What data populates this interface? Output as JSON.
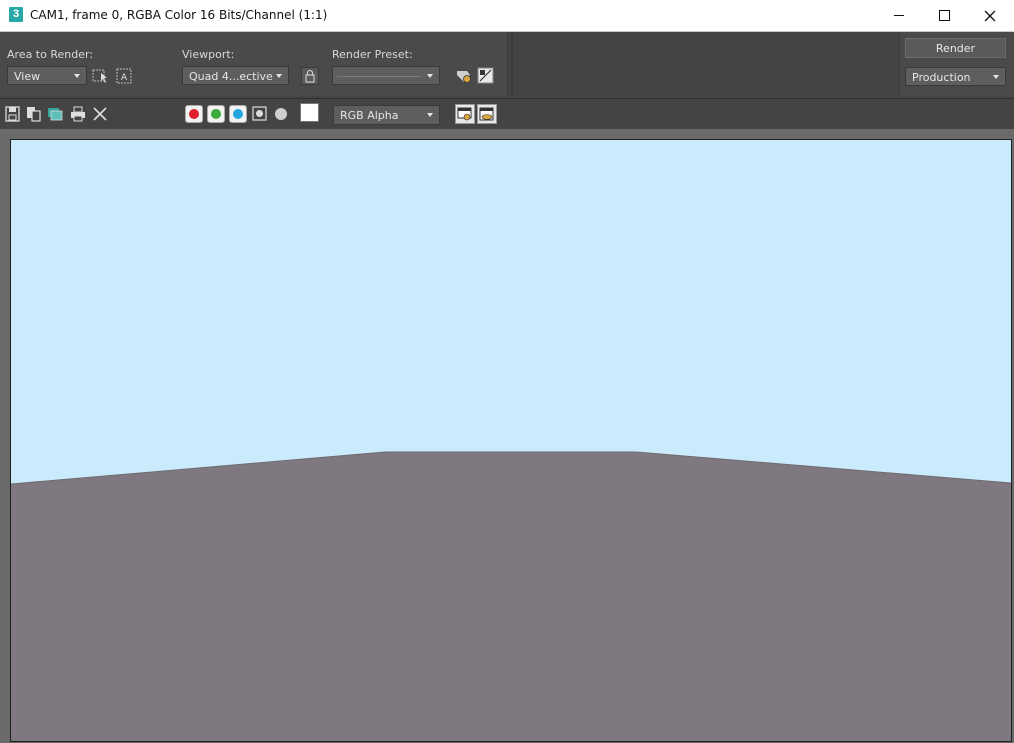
{
  "window": {
    "title": "CAM1, frame 0, RGBA Color 16 Bits/Channel (1:1)",
    "app_icon_glyph": "3",
    "buttons": [
      "minimize-icon",
      "maximize-icon",
      "close-icon"
    ]
  },
  "toolbar": {
    "area_to_render_label": "Area to Render:",
    "area_to_render_value": "View",
    "viewport_label": "Viewport:",
    "viewport_value": "Quad 4...ective",
    "render_preset_label": "Render Preset:",
    "render_preset_value": "",
    "render_button": "Render",
    "production_value": "Production"
  },
  "toolbar2": {
    "channel_display_value": "RGB Alpha",
    "channels": [
      {
        "name": "red",
        "color": "#e0202a"
      },
      {
        "name": "green",
        "color": "#3caa3c"
      },
      {
        "name": "blue",
        "color": "#1fa6e0"
      }
    ]
  },
  "render": {
    "sky_color": "#c9ebfb",
    "ground_color": "#7f7880"
  }
}
